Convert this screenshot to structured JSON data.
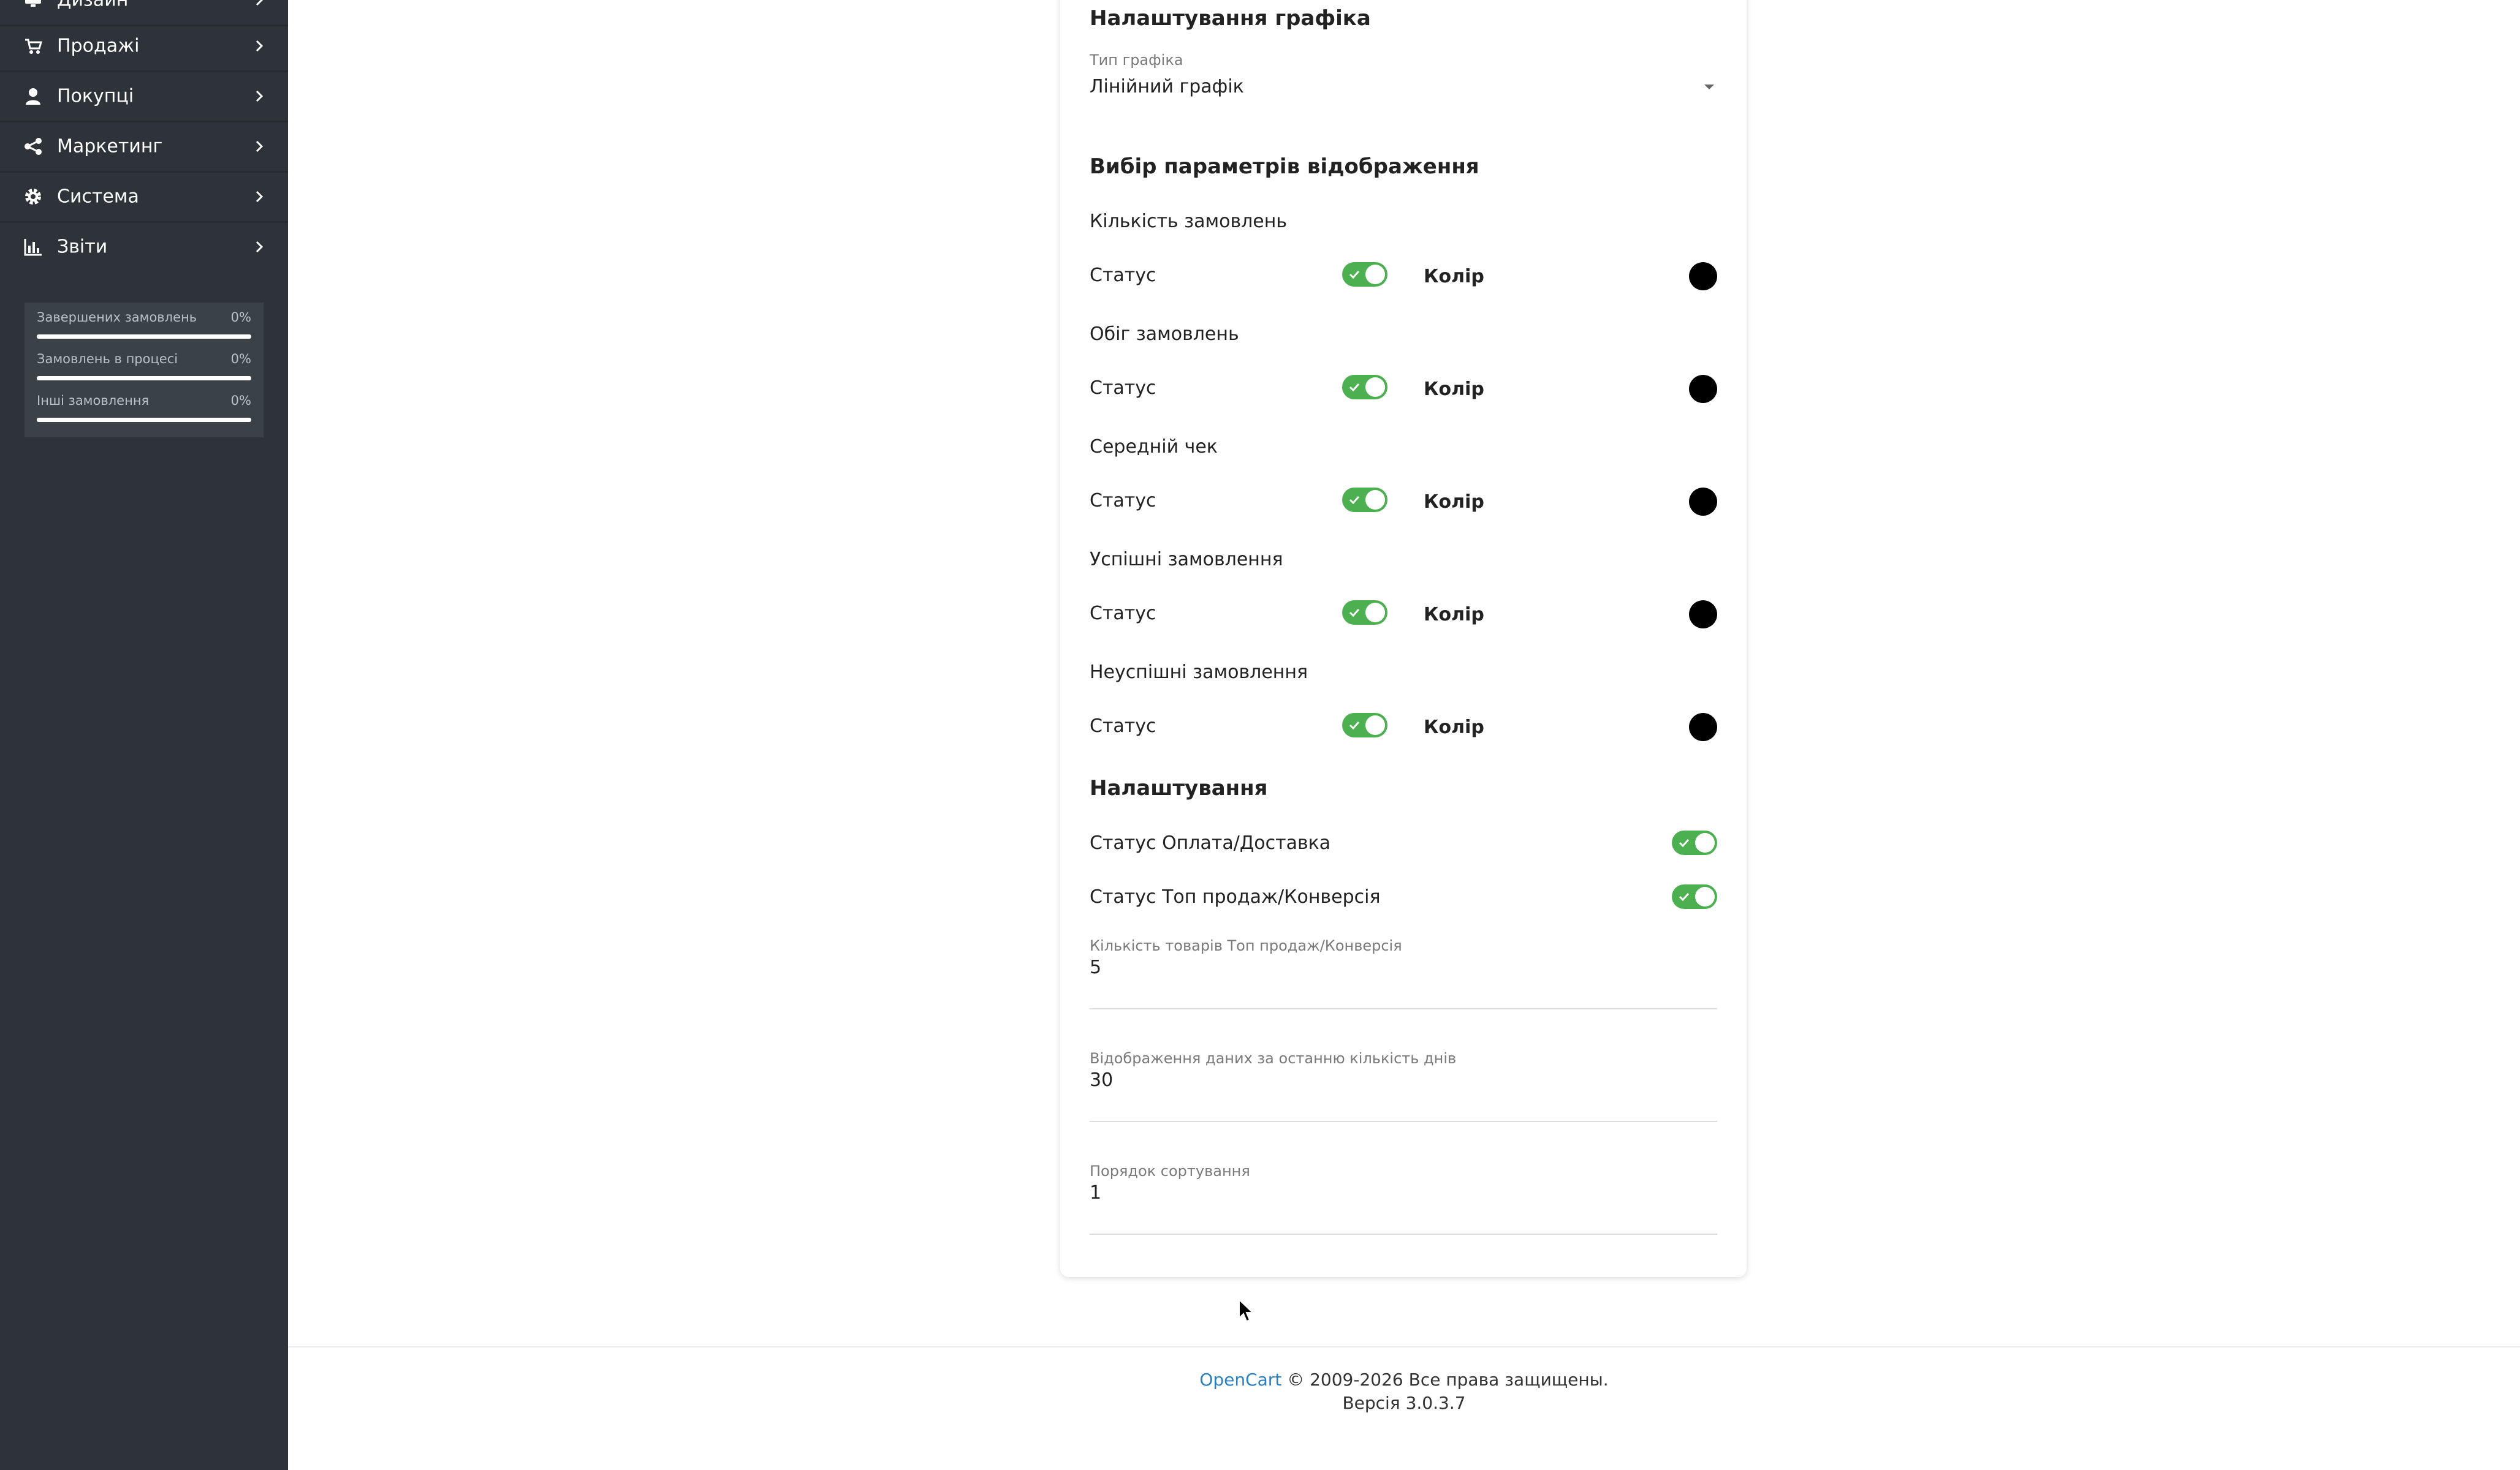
{
  "sidebar": {
    "items": [
      {
        "label": "Дизайн",
        "icon": "desktop-icon"
      },
      {
        "label": "Продажі",
        "icon": "cart-icon"
      },
      {
        "label": "Покупці",
        "icon": "user-icon"
      },
      {
        "label": "Маркетинг",
        "icon": "share-icon"
      },
      {
        "label": "Система",
        "icon": "gear-icon"
      },
      {
        "label": "Звіти",
        "icon": "bar-chart-icon"
      }
    ],
    "progress": [
      {
        "label": "Завершених замовлень",
        "value": "0%",
        "percent": 0
      },
      {
        "label": "Замовлень в процесі",
        "value": "0%",
        "percent": 0
      },
      {
        "label": "Інші замовлення",
        "value": "0%",
        "percent": 0
      }
    ]
  },
  "chart_settings": {
    "title": "Налаштування графіка",
    "type_label": "Тип графіка",
    "type_value": "Лінійний графік"
  },
  "display": {
    "title": "Вибір параметрів відображення",
    "status_label": "Статус",
    "color_label": "Колір",
    "metrics": [
      {
        "name": "Кількість замовлень",
        "status": true,
        "color": "#000000"
      },
      {
        "name": "Обіг замовлень",
        "status": true,
        "color": "#000000"
      },
      {
        "name": "Середній чек",
        "status": true,
        "color": "#000000"
      },
      {
        "name": "Успішні замовлення",
        "status": true,
        "color": "#000000"
      },
      {
        "name": "Неуспішні замовлення",
        "status": true,
        "color": "#000000"
      }
    ]
  },
  "settings": {
    "title": "Налаштування",
    "payment_delivery_label": "Статус Оплата/Доставка",
    "payment_delivery_status": true,
    "top_sales_label": "Статус Топ продаж/Конверсія",
    "top_sales_status": true,
    "top_count_label": "Кількість товарів Топ продаж/Конверсія",
    "top_count_value": "5",
    "days_label": "Відображення даних за останню кількість днів",
    "days_value": "30",
    "sort_label": "Порядок сортування",
    "sort_value": "1"
  },
  "footer": {
    "link": "OpenCart",
    "copyright": " © 2009-2026 Все права защищены.",
    "version": "Версія 3.0.3.7"
  },
  "colors": {
    "sidebar_bg": "#2d3338",
    "toggle_on": "#4caf50",
    "link": "#2a7fc0"
  }
}
